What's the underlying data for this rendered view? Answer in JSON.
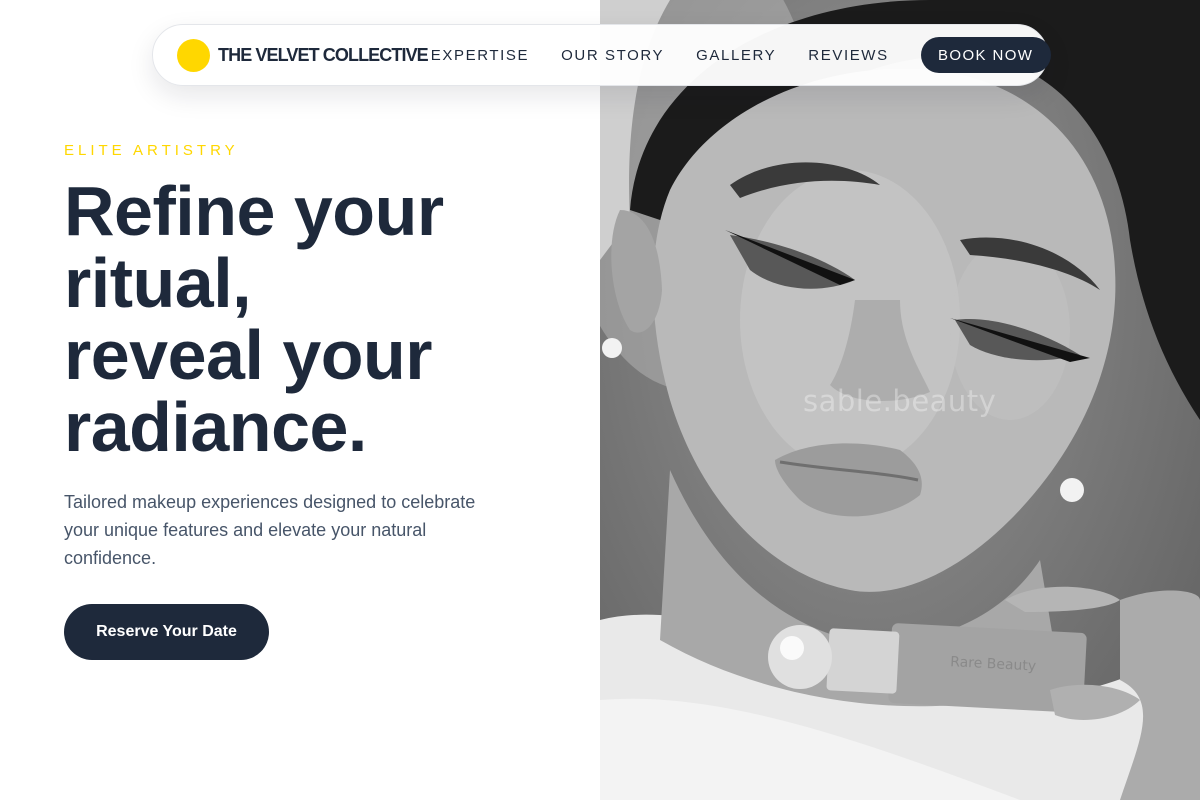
{
  "nav": {
    "brand": "THE VELVET COLLECTIVE",
    "links": [
      "EXPERTISE",
      "OUR STORY",
      "GALLERY",
      "REVIEWS"
    ],
    "cta": "BOOK NOW"
  },
  "hero": {
    "eyebrow": "ELITE ARTISTRY",
    "headline": [
      "Refine your",
      "ritual,",
      "reveal your",
      "radiance."
    ],
    "subtext": "Tailored makeup experiences designed to celebrate your unique features and elevate your natural confidence.",
    "cta": "Reserve Your Date"
  },
  "photo": {
    "watermark": "sable.beauty",
    "product_label": "Rare Beauty"
  },
  "colors": {
    "accent": "#FFD700",
    "navy": "#1e293b",
    "body_text": "#475569"
  }
}
